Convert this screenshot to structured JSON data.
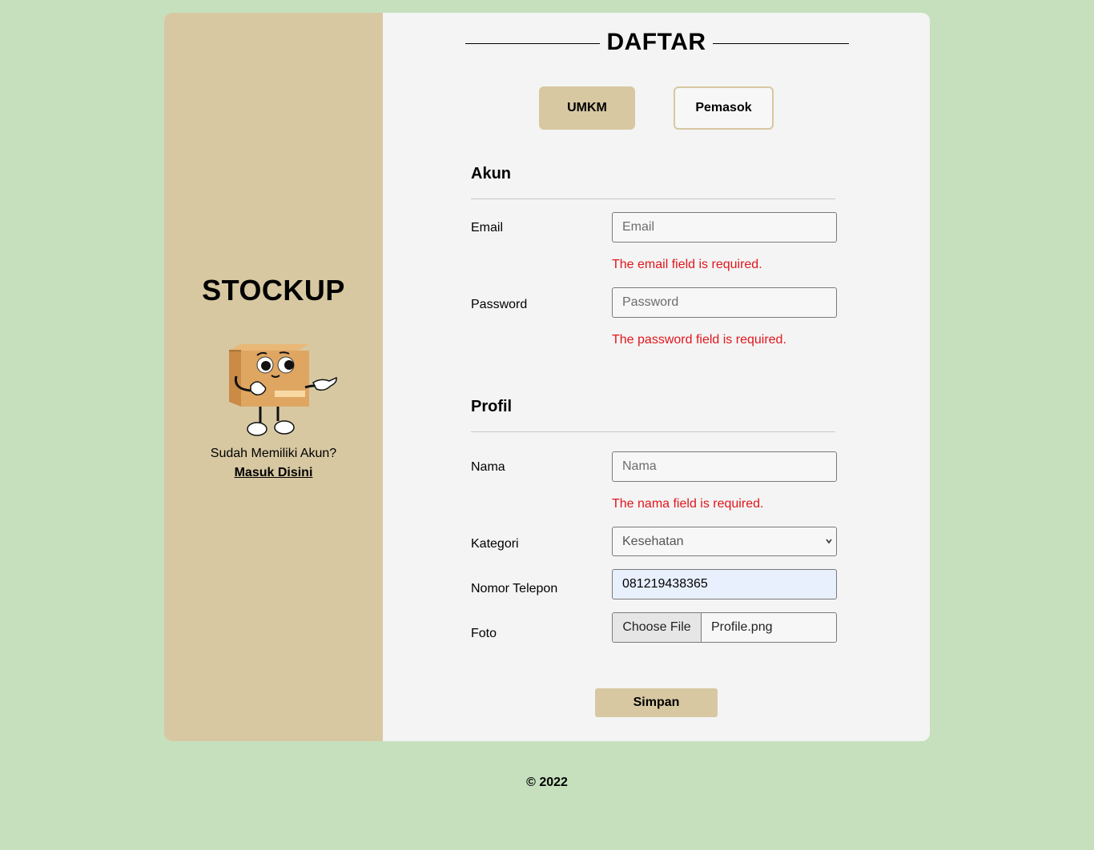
{
  "brand": {
    "name": "STOCKUP",
    "have_account_text": "Sudah Memiliki Akun?",
    "login_link": "Masuk Disini"
  },
  "page": {
    "title": "DAFTAR"
  },
  "roles": {
    "umkm": "UMKM",
    "pemasok": "Pemasok",
    "selected": "UMKM"
  },
  "akun": {
    "title": "Akun",
    "email": {
      "label": "Email",
      "placeholder": "Email",
      "value": "",
      "error": "The email field is required."
    },
    "password": {
      "label": "Password",
      "placeholder": "Password",
      "value": "",
      "error": "The password field is required."
    }
  },
  "profil": {
    "title": "Profil",
    "nama": {
      "label": "Nama",
      "placeholder": "Nama",
      "value": "",
      "error": "The nama field is required."
    },
    "kategori": {
      "label": "Kategori",
      "selected": "Kesehatan"
    },
    "telepon": {
      "label": "Nomor Telepon",
      "value": "081219438365"
    },
    "foto": {
      "label": "Foto",
      "button": "Choose File",
      "filename": "Profile.png"
    }
  },
  "actions": {
    "save": "Simpan"
  },
  "footer": {
    "copyright": "© 2022"
  },
  "colors": {
    "background": "#c6e0bd",
    "panel": "#d7c8a2",
    "error": "#e0161c",
    "autofill": "#e8f0fe"
  }
}
